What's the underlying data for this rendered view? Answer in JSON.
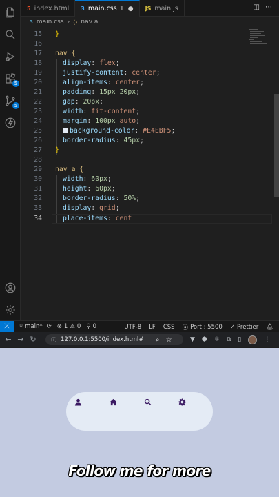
{
  "tabs": [
    {
      "icon": "html-file-icon",
      "label": "index.html",
      "badge": "",
      "active": false
    },
    {
      "icon": "css-file-icon",
      "label": "main.css",
      "badge": "1",
      "active": true
    },
    {
      "icon": "js-file-icon",
      "label": "main.js",
      "badge": "",
      "active": false
    }
  ],
  "breadcrumb": {
    "file": "main.css",
    "symbol": "nav a"
  },
  "activity_badges": {
    "extensions": "5",
    "source_control": "5"
  },
  "editor": {
    "current_line": 34,
    "lines": [
      {
        "n": "15",
        "text": "}"
      },
      {
        "n": "16",
        "text": ""
      },
      {
        "n": "17",
        "text": "nav {"
      },
      {
        "n": "18",
        "text": "display: flex;"
      },
      {
        "n": "19",
        "text": "justify-content: center;"
      },
      {
        "n": "20",
        "text": "align-items: center;"
      },
      {
        "n": "21",
        "text": "padding: 15px 20px;"
      },
      {
        "n": "22",
        "text": "gap: 20px;"
      },
      {
        "n": "23",
        "text": "width: fit-content;"
      },
      {
        "n": "24",
        "text": "margin: 100px auto;"
      },
      {
        "n": "25",
        "text": "background-color: #E4EBF5;"
      },
      {
        "n": "26",
        "text": "border-radius: 45px;"
      },
      {
        "n": "27",
        "text": "}"
      },
      {
        "n": "28",
        "text": ""
      },
      {
        "n": "29",
        "text": "nav a {"
      },
      {
        "n": "30",
        "text": "width: 60px;"
      },
      {
        "n": "31",
        "text": "height: 60px;"
      },
      {
        "n": "32",
        "text": "border-radius: 50%;"
      },
      {
        "n": "33",
        "text": "display: grid;"
      },
      {
        "n": "34",
        "text": "place-items: cent"
      }
    ],
    "background_color_swatch": "#E4EBF5"
  },
  "statusbar": {
    "branch": "main*",
    "errors": "1",
    "warnings": "0",
    "ports": "0",
    "encoding": "UTF-8",
    "eol": "LF",
    "language": "CSS",
    "port": "Port : 5500",
    "formatter": "Prettier"
  },
  "browser": {
    "url": "127.0.0.1:5500/index.html#"
  },
  "page": {
    "nav_color": "#E4EBF5",
    "background": "#C3CBE1",
    "icon_color": "#3B1A63",
    "links": [
      "user-icon",
      "home-icon",
      "search-icon",
      "gear-icon"
    ]
  },
  "caption": "Follow me for more"
}
